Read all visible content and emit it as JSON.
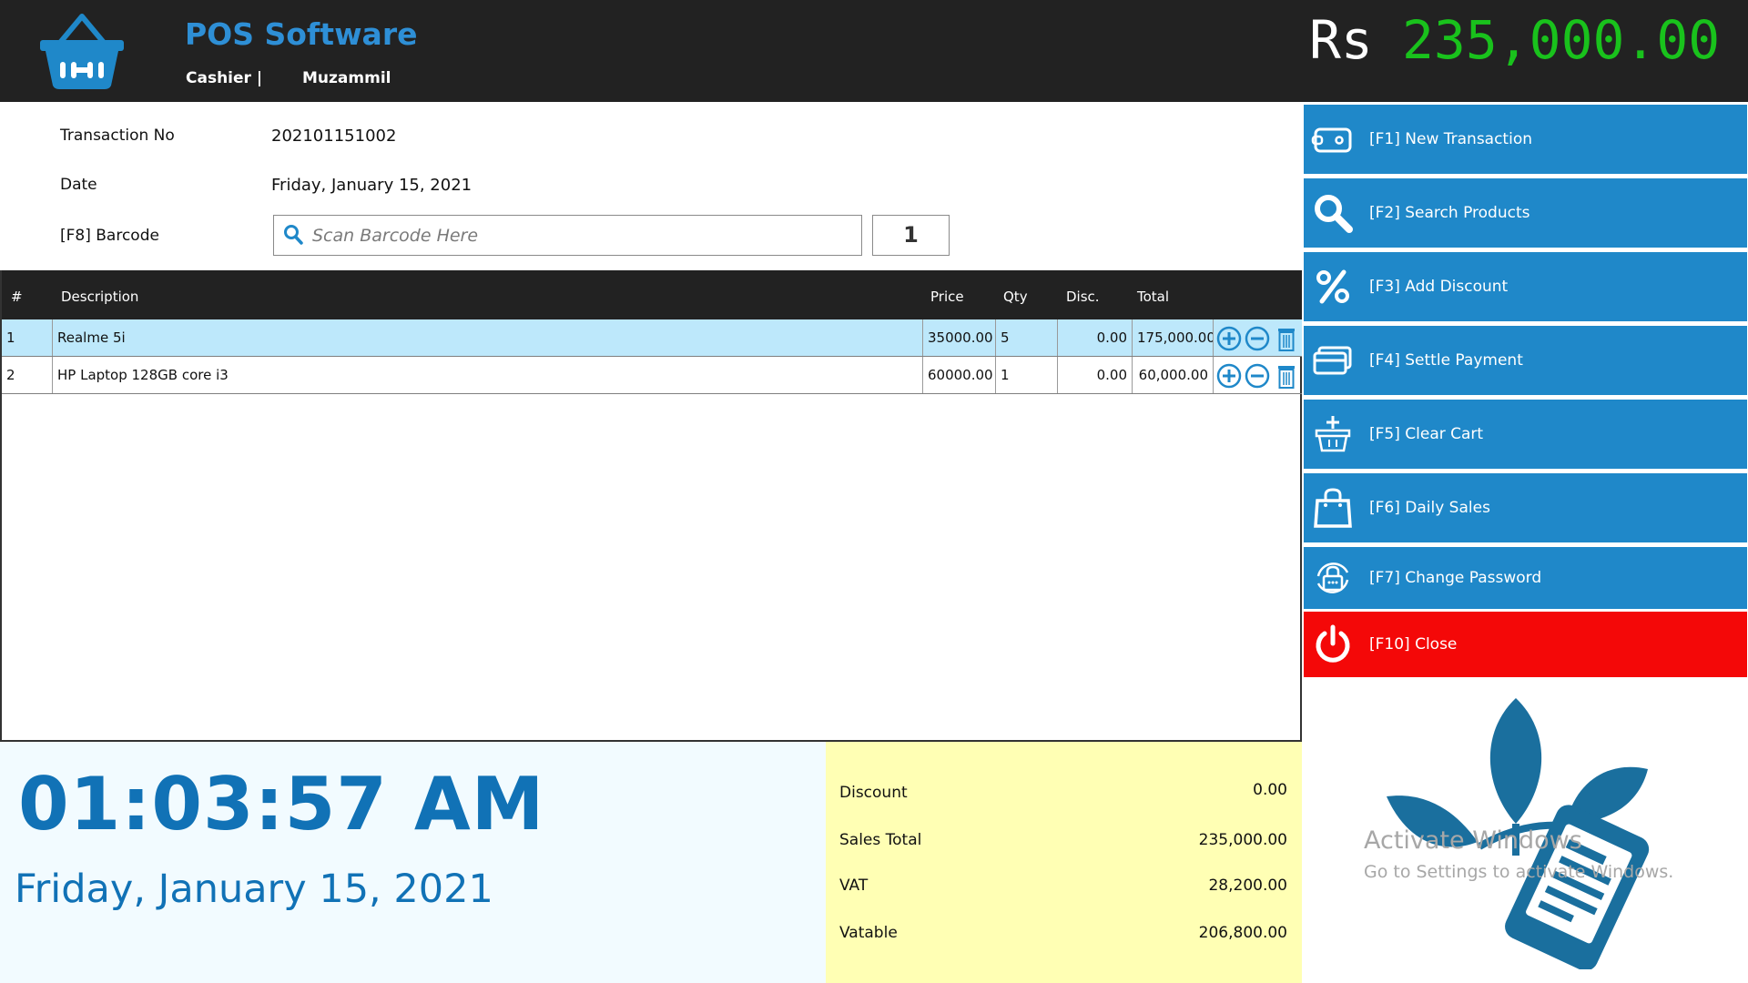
{
  "header": {
    "app_title": "POS Software",
    "cashier_label": "Cashier |",
    "cashier_name": "Muzammil",
    "total_currency": "Rs",
    "total_amount": "235,000.00",
    "title_color": "#2e8fd6",
    "amount_color": "#19c21c",
    "logo_icon": "shopping-basket-icon"
  },
  "info": {
    "transaction_label": "Transaction No",
    "transaction_value": "202101151002",
    "date_label": "Date",
    "date_value": "Friday, January 15, 2021",
    "barcode_label": "[F8] Barcode",
    "barcode_placeholder": "Scan Barcode Here",
    "barcode_value": "",
    "quantity_value": "1"
  },
  "table": {
    "columns": [
      "#",
      "Description",
      "Price",
      "Qty",
      "Disc.",
      "Total"
    ],
    "rows": [
      {
        "no": "1",
        "description": "Realme 5i",
        "price": "35000.00",
        "qty": "5",
        "disc": "0.00",
        "total": "175,000.00",
        "selected": true
      },
      {
        "no": "2",
        "description": "HP Laptop 128GB core i3",
        "price": "60000.00",
        "qty": "1",
        "disc": "0.00",
        "total": "60,000.00",
        "selected": false
      }
    ],
    "row_actions": [
      "add-icon",
      "minus-icon",
      "trash-icon"
    ]
  },
  "sidebar": {
    "buttons": [
      {
        "label": "[F1] New Transaction",
        "icon": "wallet-icon"
      },
      {
        "label": "[F2] Search Products",
        "icon": "search-icon"
      },
      {
        "label": "[F3] Add Discount",
        "icon": "percent-icon"
      },
      {
        "label": "[F4] Settle Payment",
        "icon": "credit-card-icon"
      },
      {
        "label": "[F5] Clear Cart",
        "icon": "basket-icon"
      },
      {
        "label": "[F6] Daily Sales",
        "icon": "shopping-bag-icon"
      },
      {
        "label": "[F7] Change Password",
        "icon": "lock-icon"
      },
      {
        "label": "[F10] Close",
        "icon": "power-icon"
      }
    ],
    "button_color": "#1f88c9",
    "close_color": "#f40808"
  },
  "clock": {
    "time": "01:03:57 AM",
    "date": "Friday, January 15, 2021",
    "color": "#1172b6"
  },
  "summary": {
    "discount_label": "Discount",
    "discount_value": "0.00",
    "sales_total_label": "Sales Total",
    "sales_total_value": "235,000.00",
    "vat_label": "VAT",
    "vat_value": "28,200.00",
    "vatable_label": "Vatable",
    "vatable_value": "206,800.00",
    "background": "#ffffb4"
  },
  "watermark": {
    "title": "Activate Windows",
    "subtitle": "Go to Settings to activate Windows.",
    "logo_icon": "leaf-receipt-logo-icon"
  }
}
